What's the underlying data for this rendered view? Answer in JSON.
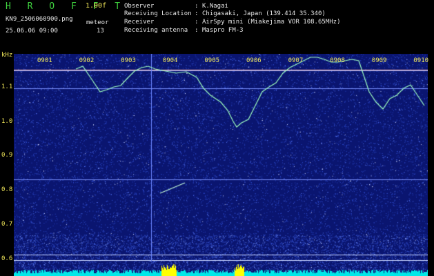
{
  "header": {
    "brand": "H R O F F T",
    "version": "1.00f",
    "filename": "KN9_2506060900.png",
    "meteor_label": "meteor",
    "datetime": "25.06.06 09:00",
    "meteor_count": "13"
  },
  "metadata": [
    {
      "label": "Observer",
      "value": "K.Nagai"
    },
    {
      "label": "Receiving Location",
      "value": "Chigasaki, Japan (139.414 35.340)"
    },
    {
      "label": "Receiver",
      "value": "AirSpy mini (Miakejima VOR 108.65MHz)"
    },
    {
      "label": "Receiving antenna",
      "value": "Maspro FM-3"
    }
  ],
  "separator": ":",
  "axis": {
    "unit": "kHz",
    "y_ticks": [
      "1.1",
      "1.0",
      "0.9",
      "0.8",
      "0.7",
      "0.6"
    ],
    "y_range": [
      0.575,
      1.17
    ],
    "x_ticks": [
      "0901",
      "0902",
      "0903",
      "0904",
      "0905",
      "0906",
      "0907",
      "0908",
      "0909",
      "0910"
    ]
  },
  "colors": {
    "background": "#0a1570",
    "signal": "#9fffbf",
    "meteor_bar": "#00e8e8",
    "meteor_burst": "#ffff00",
    "label_yellow": "#f2e85a",
    "label_green": "#3fd23f"
  }
}
